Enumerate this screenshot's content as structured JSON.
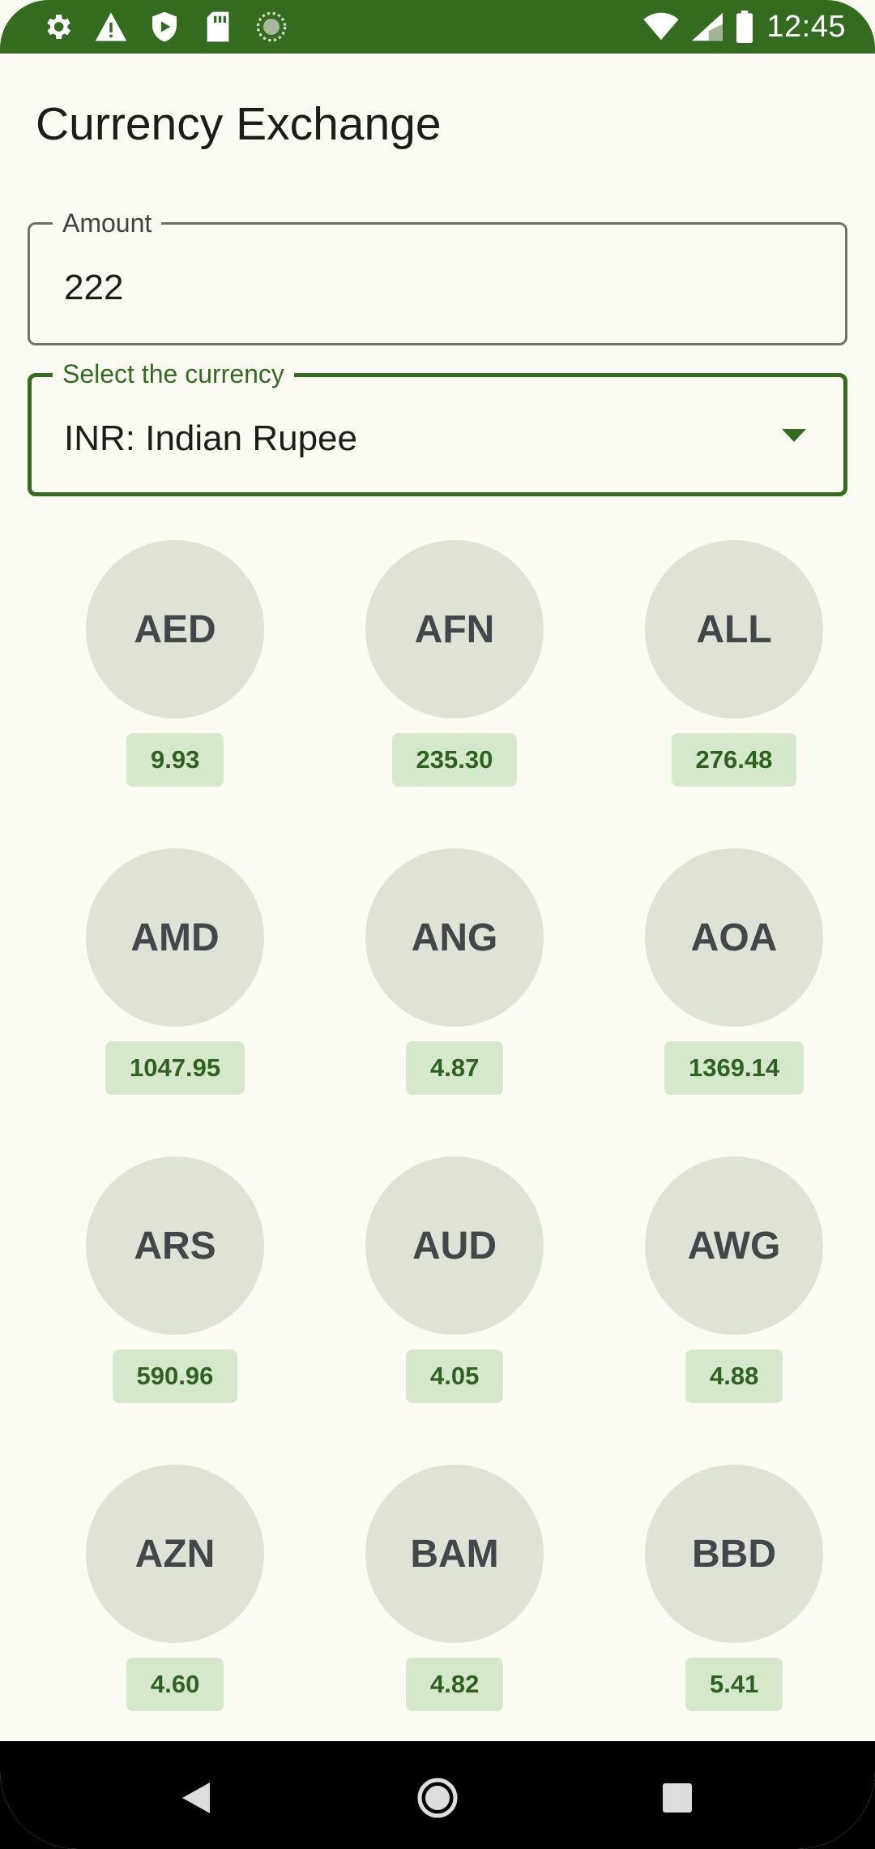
{
  "status_bar": {
    "time": "12:45",
    "left_icons": [
      "settings-icon",
      "warning-icon",
      "shield-icon",
      "sd-card-icon",
      "sync-icon"
    ],
    "right_icons": [
      "wifi-icon",
      "signal-icon",
      "battery-icon"
    ]
  },
  "app": {
    "title": "Currency Exchange"
  },
  "amount_field": {
    "label": "Amount",
    "value": "222"
  },
  "currency_field": {
    "label": "Select the currency",
    "value": "INR: Indian Rupee"
  },
  "currencies": [
    {
      "code": "AED",
      "value": "9.93"
    },
    {
      "code": "AFN",
      "value": "235.30"
    },
    {
      "code": "ALL",
      "value": "276.48"
    },
    {
      "code": "AMD",
      "value": "1047.95"
    },
    {
      "code": "ANG",
      "value": "4.87"
    },
    {
      "code": "AOA",
      "value": "1369.14"
    },
    {
      "code": "ARS",
      "value": "590.96"
    },
    {
      "code": "AUD",
      "value": "4.05"
    },
    {
      "code": "AWG",
      "value": "4.88"
    },
    {
      "code": "AZN",
      "value": "4.60"
    },
    {
      "code": "BAM",
      "value": "4.82"
    },
    {
      "code": "BBD",
      "value": "5.41"
    }
  ],
  "colors": {
    "primary": "#336b1f",
    "background": "#fbfbf3",
    "circle": "#dfe3d6",
    "badge": "#d6e8cc",
    "badge_text": "#2f6221"
  }
}
